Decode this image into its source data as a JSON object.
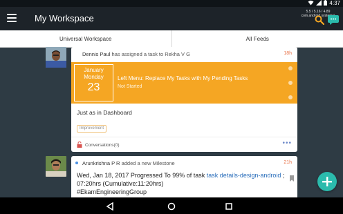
{
  "status_bar": {
    "time": "4:37",
    "icons": [
      "wifi-icon",
      "signal-icon",
      "battery-icon"
    ]
  },
  "app_bar": {
    "title": "My Workspace",
    "debug_text": "5.5 / 5.16 / 4.89\n com.android.systemui",
    "icons": [
      "menu-icon",
      "search-icon",
      "chat-icon"
    ]
  },
  "tabs": [
    {
      "label": "Universal Workspace"
    },
    {
      "label": "All Feeds"
    }
  ],
  "feed": [
    {
      "actor": "Dennis Paul",
      "action": " has assigned a task to Rekha V G",
      "time": "18h",
      "task": {
        "month": "January",
        "weekday": "Monday",
        "day": "23",
        "title": "Left Menu: Replace My Tasks with My Pending Tasks",
        "status": "Not Started"
      },
      "description": "Just as in Dashboard",
      "tag": "Improvement",
      "conversations": "Conversations(0)",
      "more": "•••"
    },
    {
      "actor": "Arunkrishna P R",
      "action": " added a new Milestone",
      "time": "21h",
      "text_part1": "Wed, Jan 18, 2017 Progressed To 99% of task ",
      "text_link": "task details-design-android",
      "text_part2": " ; 07:20hrs (Cumulative:11:20hrs)",
      "hashtag": "#EkamEngineeringGroup"
    }
  ],
  "fab": {
    "icon": "plus-icon"
  },
  "nav_bar": {
    "icons": [
      "back-icon",
      "home-icon",
      "recents-icon"
    ]
  },
  "colors": {
    "app_bar": "#1d2329",
    "background": "#2e3b44",
    "task_orange": "#f5a623",
    "fab_teal": "#2bbbad",
    "time_accent": "#e8734a",
    "link_blue": "#2a6ebb"
  }
}
